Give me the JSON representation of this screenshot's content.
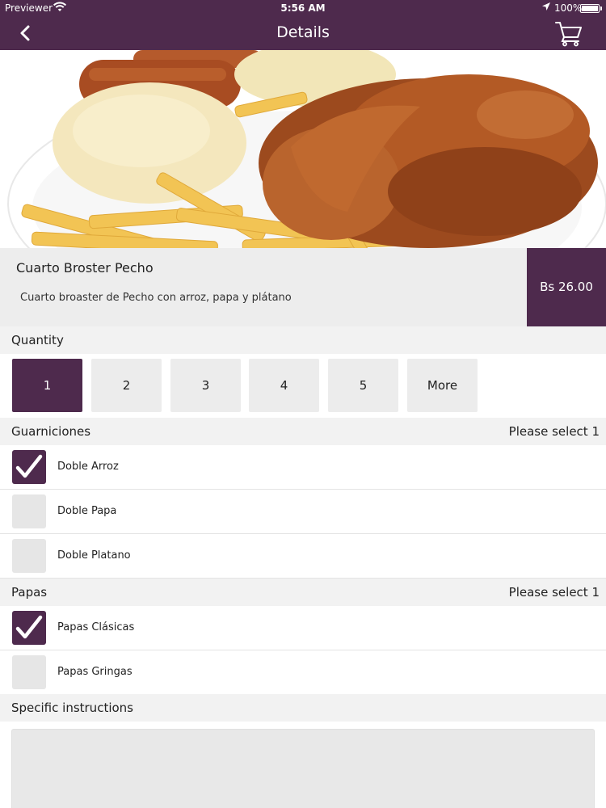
{
  "statusbar": {
    "carrier": "Previewer",
    "time": "5:56 AM",
    "battery": "100%"
  },
  "nav": {
    "title": "Details"
  },
  "product": {
    "name": "Cuarto Broster Pecho",
    "description": "Cuarto broaster de Pecho con arroz, papa y plátano",
    "price": "Bs 26.00"
  },
  "quantity": {
    "label": "Quantity",
    "options": [
      "1",
      "2",
      "3",
      "4",
      "5",
      "More"
    ],
    "selected": "1"
  },
  "guarniciones": {
    "label": "Guarniciones",
    "hint": "Please select 1",
    "options": [
      {
        "label": "Doble Arroz",
        "checked": true
      },
      {
        "label": "Doble Papa",
        "checked": false
      },
      {
        "label": "Doble Platano",
        "checked": false
      }
    ]
  },
  "papas": {
    "label": "Papas",
    "hint": "Please select 1",
    "options": [
      {
        "label": "Papas Clásicas",
        "checked": true
      },
      {
        "label": "Papas Gringas",
        "checked": false
      }
    ]
  },
  "instructions": {
    "label": "Specific instructions",
    "value": ""
  },
  "colors": {
    "brand": "#4e2a4d",
    "section_bg": "#f2f2f2",
    "unchecked_bg": "#e6e6e6"
  }
}
